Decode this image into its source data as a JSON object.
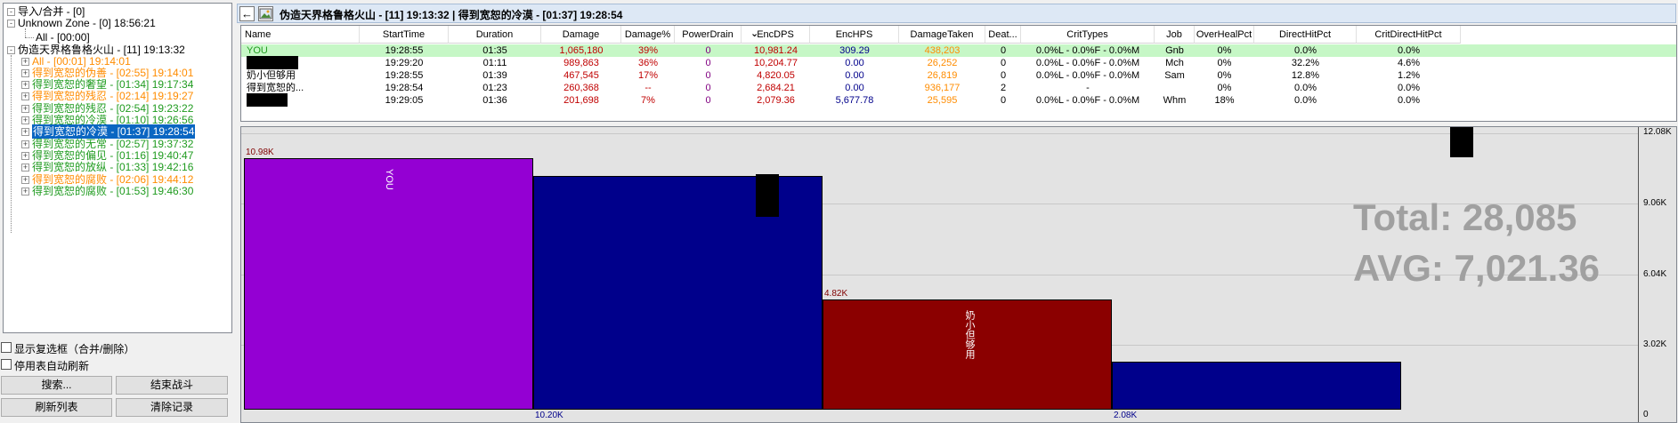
{
  "tree": {
    "n0": "导入/合并 - [0]",
    "n1": "Unknown Zone - [0] 18:56:21",
    "n2": "All - [00:00]",
    "n3": "伪造天界格鲁格火山 - [11] 19:13:32",
    "items": [
      "All - [00:01] 19:14:01",
      "得到宽恕的伪善 - [02:55] 19:14:01",
      "得到宽恕的奢望 - [01:34] 19:17:34",
      "得到宽恕的残忍 - [02:14] 19:19:27",
      "得到宽恕的残忍 - [02:54] 19:23:22",
      "得到宽恕的冷漠 - [01:10] 19:26:56",
      "得到宽恕的冷漠 - [01:37] 19:28:54",
      "得到宽恕的无常 - [02:57] 19:37:32",
      "得到宽恕的偏见 - [01:16] 19:40:47",
      "得到宽恕的放纵 - [01:33] 19:42:16",
      "得到宽恕的腐败 - [02:06] 19:44:12",
      "得到宽恕的腐败 - [01:53] 19:46:30"
    ]
  },
  "options": {
    "show_checkbox": "显示复选框（合并/删除）",
    "disable_refresh": "停用表自动刷新"
  },
  "buttons": {
    "search": "搜索...",
    "end_battle": "结束战斗",
    "refresh": "刷新列表",
    "clear": "清除记录"
  },
  "title": "伪造天界格鲁格火山 - [11] 19:13:32 | 得到宽恕的冷漠 - [01:37] 19:28:54",
  "columns": [
    "Name",
    "StartTime",
    "Duration",
    "Damage",
    "Damage%",
    "PowerDrain",
    "EncDPS",
    "EncHPS",
    "DamageTaken",
    "Deat...",
    "CritTypes",
    "Job",
    "OverHealPct",
    "DirectHitPct",
    "CritDirectHitPct"
  ],
  "sort_arrow": "⌄",
  "rows": [
    [
      "YOU",
      "19:28:55",
      "01:35",
      "1,065,180",
      "39%",
      "0",
      "10,981.24",
      "309.29",
      "438,203",
      "0",
      "0.0%L - 0.0%F - 0.0%M",
      "Gnb",
      "0%",
      "0.0%",
      "0.0%"
    ],
    [
      "",
      "19:29:20",
      "01:11",
      "989,863",
      "36%",
      "0",
      "10,204.77",
      "0.00",
      "26,252",
      "0",
      "0.0%L - 0.0%F - 0.0%M",
      "Mch",
      "0%",
      "32.2%",
      "4.6%"
    ],
    [
      "奶小但够用",
      "19:28:55",
      "01:39",
      "467,545",
      "17%",
      "0",
      "4,820.05",
      "0.00",
      "26,819",
      "0",
      "0.0%L - 0.0%F - 0.0%M",
      "Sam",
      "0%",
      "12.8%",
      "1.2%"
    ],
    [
      "得到宽恕的...",
      "19:28:54",
      "01:23",
      "260,368",
      "--",
      "0",
      "2,684.21",
      "0.00",
      "936,177",
      "2",
      "-",
      "",
      "0%",
      "0.0%",
      "0.0%"
    ],
    [
      "",
      "19:29:05",
      "01:36",
      "201,698",
      "7%",
      "0",
      "2,079.36",
      "5,677.78",
      "25,595",
      "0",
      "0.0%L - 0.0%F - 0.0%M",
      "Whm",
      "18%",
      "0.0%",
      "0.0%"
    ]
  ],
  "graph": {
    "yticks": [
      "12.08K",
      "9.06K",
      "6.04K",
      "3.02K",
      "0"
    ],
    "total": "Total: 28,085",
    "avg": "AVG: 7,021.36"
  },
  "chart_data": {
    "type": "bar",
    "categories": [
      "YOU",
      "",
      "奶小但够用",
      ""
    ],
    "values": [
      10.98,
      10.2,
      4.82,
      2.08
    ],
    "value_labels": [
      "10.98K",
      "10.20K",
      "4.82K",
      "2.08K"
    ],
    "colors": [
      "#9400d3",
      "#00008b",
      "#8b0000",
      "#00008b"
    ],
    "ylim": [
      0,
      12.08
    ],
    "yticks": [
      "12.08K",
      "9.06K",
      "6.04K",
      "3.02K",
      "0"
    ],
    "grid": true
  }
}
